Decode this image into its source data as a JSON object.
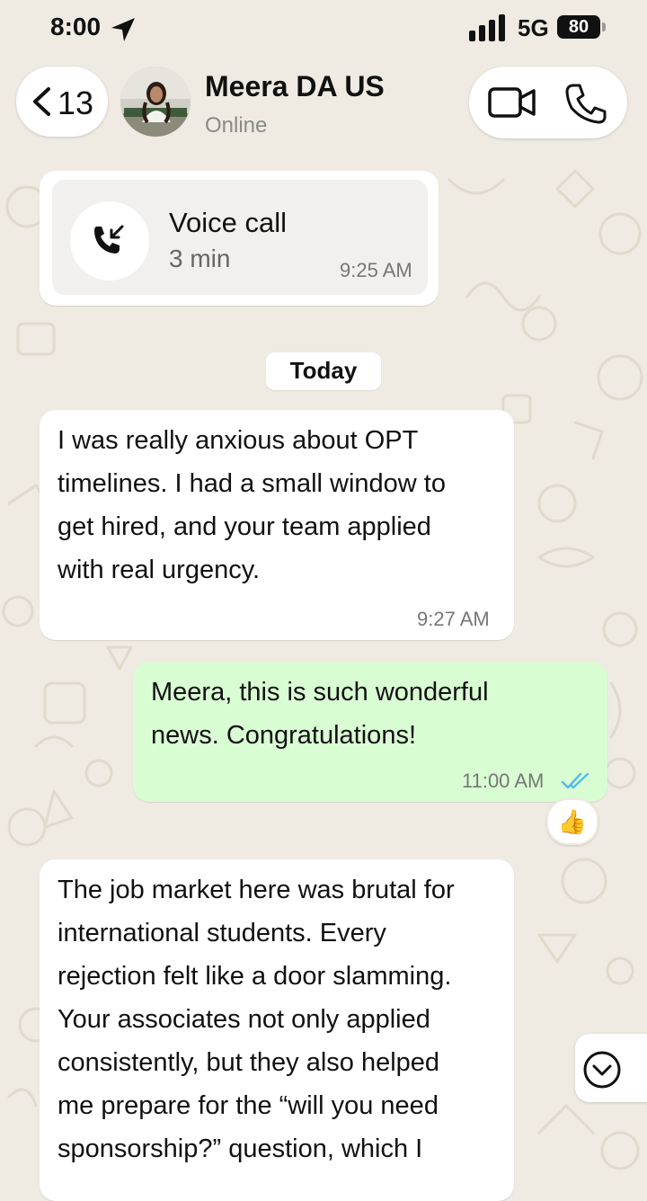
{
  "status_bar": {
    "time": "8:00",
    "network": "5G",
    "battery": "80",
    "icons": [
      "location-arrow-icon",
      "signal-bars-icon"
    ]
  },
  "header": {
    "back_count": "13",
    "contact_name": "Meera DA US",
    "contact_status": "Online",
    "icons": [
      "back-chevron-icon",
      "video-camera-icon",
      "phone-icon"
    ]
  },
  "call_card": {
    "title": "Voice call",
    "duration": "3 min",
    "time": "9:25 AM",
    "icon": "incoming-call-icon"
  },
  "date_divider": "Today",
  "messages": [
    {
      "direction": "in",
      "text": "I was really anxious about OPT\ntimelines. I had a small window to\nget hired, and your team applied\nwith real urgency.",
      "time": "9:27 AM"
    },
    {
      "direction": "out",
      "text": "Meera, this is such wonderful\nnews. Congratulations!",
      "time": "11:00 AM",
      "read_receipt": "double-check-icon",
      "reaction": "👍"
    },
    {
      "direction": "in",
      "text": "The job market here was brutal for\ninternational students. Every\nrejection felt like a door slamming.\nYour associates not only applied\nconsistently, but they also helped\nme prepare for the “will you need\nsponsorship?” question, which I"
    }
  ],
  "scroll_button_icon": "chevron-down-circle-icon",
  "colors": {
    "background": "#efeae2",
    "outgoing_bubble": "#d9fdd3",
    "incoming_bubble": "#ffffff",
    "read_receipt": "#53bdeb",
    "status_gray": "#8a8a8a"
  }
}
